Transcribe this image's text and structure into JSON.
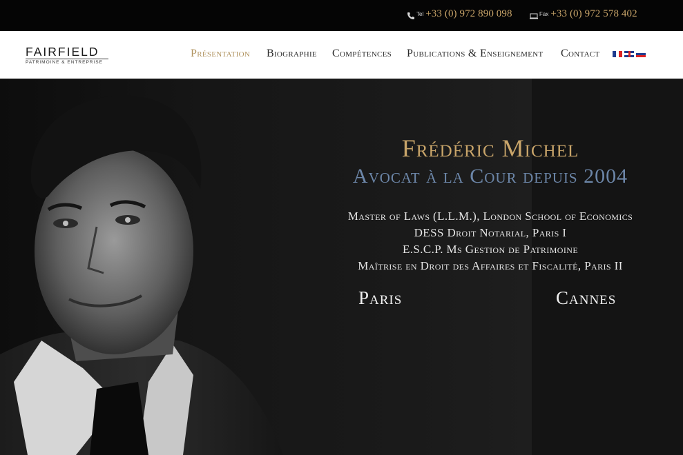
{
  "contact": {
    "tel_tag": "Tel",
    "tel": "+33 (0) 972 890 098",
    "fax_tag": "Fax",
    "fax": "+33 (0) 972 578 402"
  },
  "logo": {
    "name": "FAIRFIELD",
    "tagline": "Patrimoine & Entreprise"
  },
  "nav": {
    "items": [
      {
        "label": "Présentation",
        "active": true
      },
      {
        "label": "Biographie"
      },
      {
        "label": "Compétences"
      },
      {
        "label": "Publications & Enseignement"
      },
      {
        "label": "Contact"
      }
    ],
    "languages": [
      "fr-flag-icon",
      "uk-flag-icon",
      "ru-flag-icon"
    ]
  },
  "hero": {
    "name": "Frédéric Michel",
    "role": "Avocat à la Cour depuis 2004",
    "credentials": [
      "Master of Laws (L.L.M.), London School of Economics",
      "DESS Droit Notarial, Paris I",
      "E.S.C.P. Ms Gestion de Patrimoine",
      "Maîtrise en Droit des Affaires et Fiscalité, Paris II"
    ],
    "cities": [
      "Paris",
      "Cannes"
    ]
  },
  "colors": {
    "accent_gold": "#c9a56a",
    "accent_blue": "#6c86a8",
    "nav_active": "#b0935f"
  }
}
